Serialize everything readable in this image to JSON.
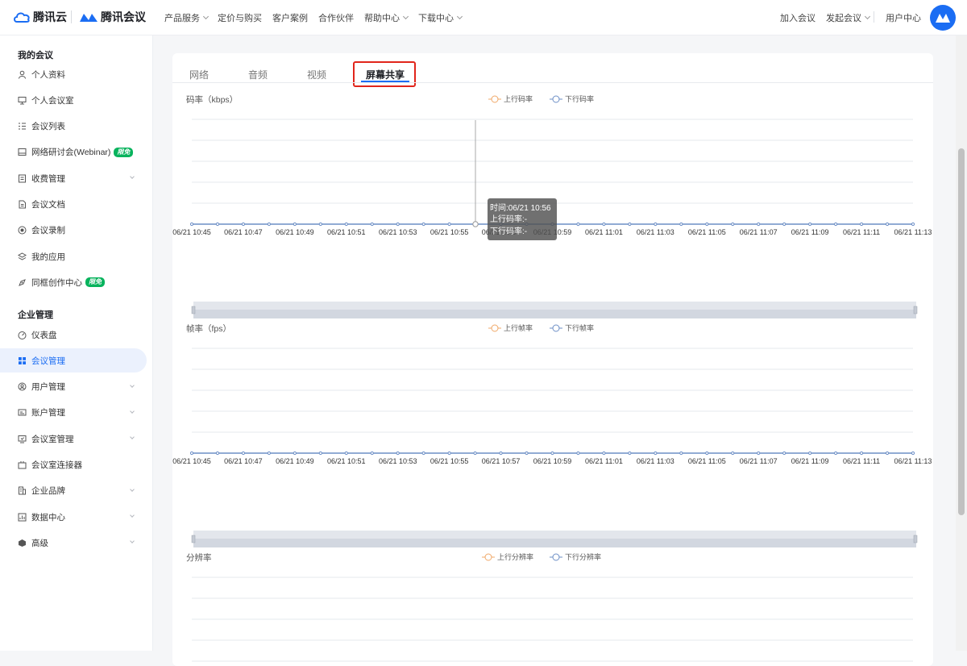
{
  "header": {
    "brand_cloud": "腾讯云",
    "brand_meeting": "腾讯会议",
    "nav": [
      "产品服务",
      "定价与购买",
      "客户案例",
      "合作伙伴",
      "帮助中心",
      "下载中心"
    ],
    "right": [
      "加入会议",
      "发起会议",
      "用户中心"
    ]
  },
  "sidebar": {
    "section1": "我的会议",
    "items1": [
      {
        "label": "个人资料",
        "icon": "user-icon"
      },
      {
        "label": "个人会议室",
        "icon": "monitor-icon"
      },
      {
        "label": "会议列表",
        "icon": "list-icon"
      },
      {
        "label": "网络研讨会(Webinar)",
        "icon": "webinar-icon",
        "badge": "限免"
      },
      {
        "label": "收费管理",
        "icon": "coin-icon"
      },
      {
        "label": "会议文档",
        "icon": "document-icon"
      },
      {
        "label": "会议录制",
        "icon": "record-icon"
      },
      {
        "label": "我的应用",
        "icon": "layers-icon"
      },
      {
        "label": "同框创作中心",
        "icon": "creative-icon",
        "badge": "限免"
      }
    ],
    "section2": "企业管理",
    "items2": [
      {
        "label": "仪表盘",
        "icon": "dashboard-icon"
      },
      {
        "label": "会议管理",
        "icon": "grid-icon"
      },
      {
        "label": "用户管理",
        "icon": "users-icon"
      },
      {
        "label": "账户管理",
        "icon": "account-icon"
      },
      {
        "label": "会议室管理",
        "icon": "room-icon"
      },
      {
        "label": "会议室连接器",
        "icon": "connector-icon"
      },
      {
        "label": "企业品牌",
        "icon": "building-icon"
      },
      {
        "label": "数据中心",
        "icon": "data-icon"
      },
      {
        "label": "高级",
        "icon": "cube-icon"
      }
    ]
  },
  "tabs": [
    "网络",
    "音频",
    "视频",
    "屏幕共享"
  ],
  "tooltip": {
    "time": "时间:06/21 10:56",
    "up": "上行码率:-",
    "down": "下行码率:-"
  },
  "colors": {
    "accent": "#1b6df3",
    "series_up": "#f0a868",
    "series_down": "#6d8fc6",
    "highlight": "#e1251b",
    "badge": "#08b35d"
  },
  "chart_data": [
    {
      "type": "line",
      "ylabel": "码率（kbps）",
      "legend_placement": "top-center",
      "categories": [
        "06/21 10:45",
        "06/21 10:47",
        "06/21 10:49",
        "06/21 10:51",
        "06/21 10:53",
        "06/21 10:55",
        "06/21 10:57",
        "06/21 10:59",
        "06/21 11:01",
        "06/21 11:03",
        "06/21 11:05",
        "06/21 11:07",
        "06/21 11:09",
        "06/21 11:11",
        "06/21 11:13"
      ],
      "series": [
        {
          "name": "上行码率"
        },
        {
          "name": "下行码率"
        }
      ],
      "grid": true
    },
    {
      "type": "line",
      "ylabel": "帧率（fps）",
      "legend_placement": "top-center",
      "categories": [
        "06/21 10:45",
        "06/21 10:47",
        "06/21 10:49",
        "06/21 10:51",
        "06/21 10:53",
        "06/21 10:55",
        "06/21 10:57",
        "06/21 10:59",
        "06/21 11:01",
        "06/21 11:03",
        "06/21 11:05",
        "06/21 11:07",
        "06/21 11:09",
        "06/21 11:11",
        "06/21 11:13"
      ],
      "series": [
        {
          "name": "上行帧率"
        },
        {
          "name": "下行帧率"
        }
      ],
      "grid": true
    },
    {
      "type": "line",
      "ylabel": "分辨率",
      "legend_placement": "top-center",
      "categories": [],
      "series": [
        {
          "name": "上行分辨率"
        },
        {
          "name": "下行分辨率"
        }
      ],
      "grid": true
    }
  ]
}
